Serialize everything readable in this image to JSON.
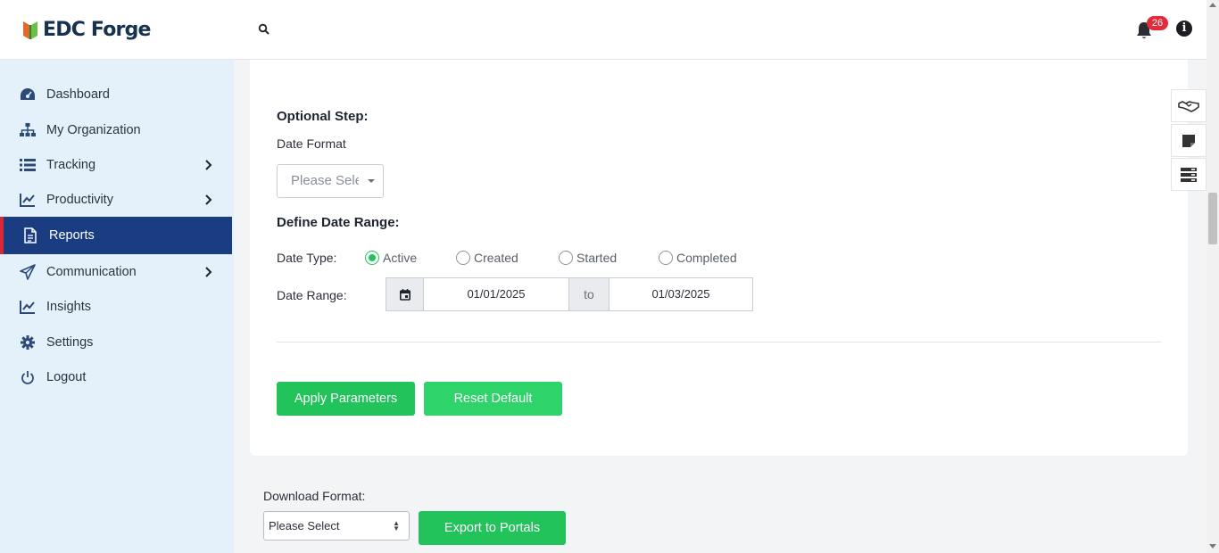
{
  "brand": {
    "name": "EDC Forge"
  },
  "header": {
    "notification_count": "26"
  },
  "sidebar": {
    "items": [
      {
        "label": "Dashboard",
        "icon": "dashboard-icon"
      },
      {
        "label": "My Organization",
        "icon": "org-chart-icon"
      },
      {
        "label": "Tracking",
        "icon": "list-icon",
        "has_submenu": true
      },
      {
        "label": "Productivity",
        "icon": "line-chart-icon",
        "has_submenu": true
      },
      {
        "label": "Reports",
        "icon": "document-icon",
        "active": true
      },
      {
        "label": "Communication",
        "icon": "paper-plane-icon",
        "has_submenu": true
      },
      {
        "label": "Insights",
        "icon": "line-chart-icon"
      },
      {
        "label": "Settings",
        "icon": "gear-icon"
      },
      {
        "label": "Logout",
        "icon": "power-icon"
      }
    ]
  },
  "form": {
    "optional_step_title": "Optional Step:",
    "date_format_label": "Date Format",
    "date_format_placeholder": "Please Select",
    "define_range_title": "Define Date Range:",
    "date_type_label": "Date Type:",
    "date_types": [
      {
        "label": "Active",
        "checked": true
      },
      {
        "label": "Created",
        "checked": false
      },
      {
        "label": "Started",
        "checked": false
      },
      {
        "label": "Completed",
        "checked": false
      }
    ],
    "date_range_label": "Date Range:",
    "date_from": "01/01/2025",
    "date_to_separator": "to",
    "date_to": "01/03/2025",
    "apply_label": "Apply Parameters",
    "reset_label": "Reset Default"
  },
  "download": {
    "label": "Download Format:",
    "select_value": "Please Select",
    "export_label": "Export to Portals"
  },
  "colors": {
    "accent_green": "#22c35b",
    "sidebar_active": "#1a3c80",
    "sidebar_bg": "#e4f1fb",
    "badge_red": "#e02b3a"
  }
}
